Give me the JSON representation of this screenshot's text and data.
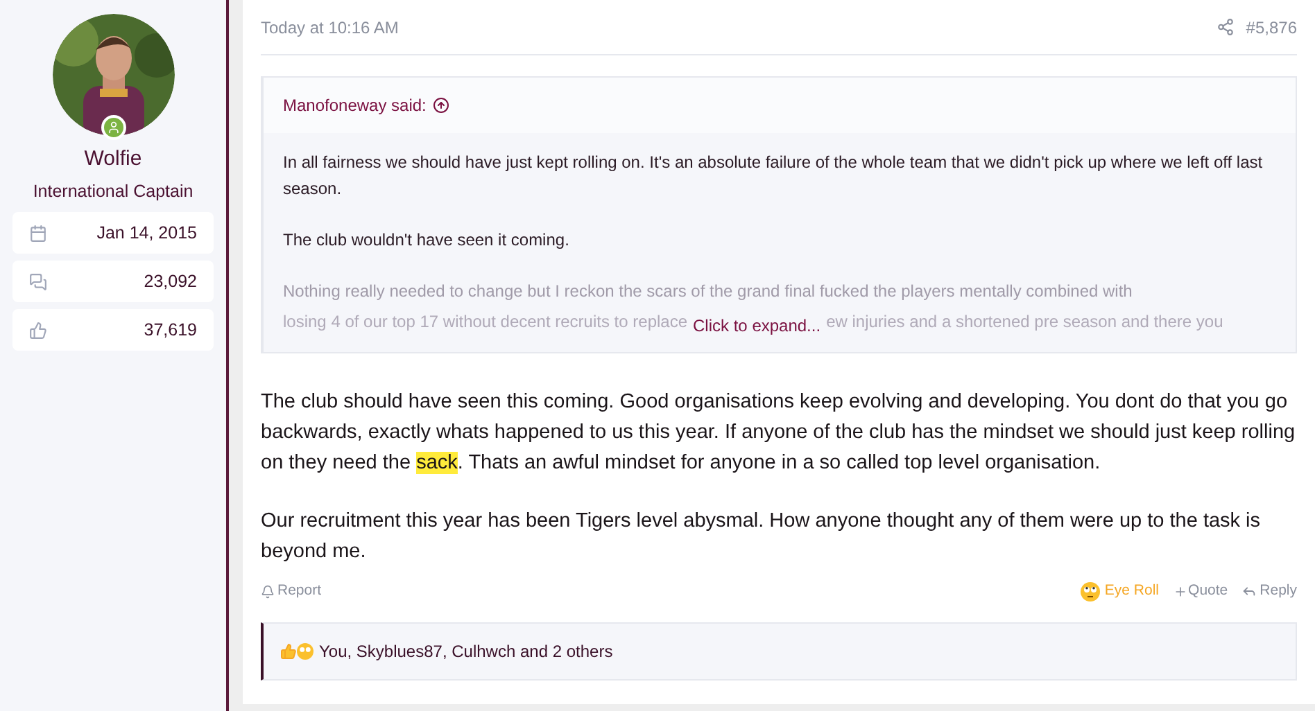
{
  "user": {
    "name": "Wolfie",
    "title": "International Captain",
    "online": true,
    "stats": [
      {
        "kind": "joined",
        "value": "Jan 14, 2015"
      },
      {
        "kind": "messages",
        "value": "23,092"
      },
      {
        "kind": "reactions",
        "value": "37,619"
      }
    ]
  },
  "post": {
    "time": "Today at 10:16 AM",
    "number": "#5,876"
  },
  "quote": {
    "author": "Manofoneway said:",
    "paragraphs": [
      "In all fairness we should have just kept rolling on. It's an absolute failure of the whole team that we didn't pick up where we left off last season.",
      "The club wouldn't have seen it coming."
    ],
    "faded": "Nothing really needed to change but I reckon the scars of the grand final fucked the players mentally combined with",
    "faded_left": "losing 4 of our top 17 without decent recruits to replace",
    "expand": "Click to expand...",
    "faded_right": "ew injuries and a shortened pre season and there you"
  },
  "body": [
    {
      "segments": [
        {
          "text": "The club should have seen this coming. Good organisations keep evolving and developing. You dont do that you go backwards, exactly whats happened to us this year. If anyone of the club has the mindset we should just keep rolling on they need the ",
          "highlighted": false
        },
        {
          "text": "sack",
          "highlighted": true
        },
        {
          "text": ". Thats an awful mindset for anyone in a so called top level organisation.",
          "highlighted": false
        }
      ]
    },
    {
      "segments": [
        {
          "text": "Our recruitment this year has been Tigers level abysmal. How anyone thought any of them were up to the task is beyond me.",
          "highlighted": false
        }
      ]
    }
  ],
  "actions": {
    "report": "Report",
    "reaction": {
      "label": "Eye Roll",
      "selected": true
    },
    "quote": "Quote",
    "reply": "Reply"
  },
  "reactions_bar": {
    "text": "You, Skyblues87, Culhwch and 2 others"
  }
}
